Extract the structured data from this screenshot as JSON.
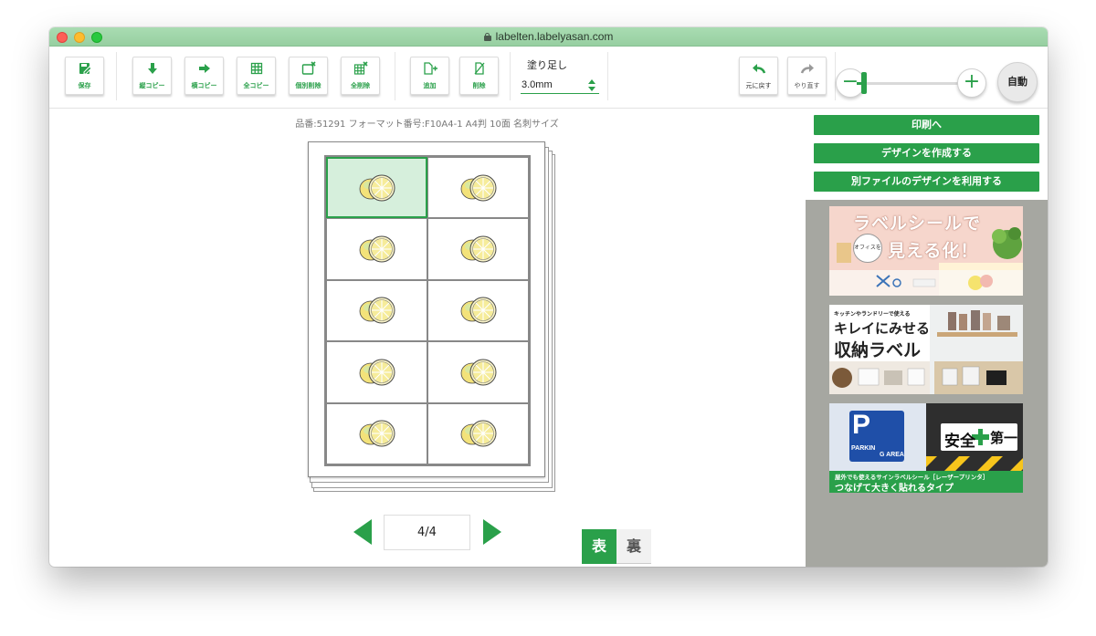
{
  "window": {
    "url": "labelten.labelyasan.com"
  },
  "toolbar": {
    "save": "保存",
    "vertical_copy": "縦コピー",
    "horizontal_copy": "横コピー",
    "all_copy": "全コピー",
    "individual_delete": "個別削除",
    "delete_all": "全削除",
    "add": "追加",
    "delete": "削除",
    "bleed_label": "塗り足し",
    "bleed_value": "3.0mm",
    "undo": "元に戻す",
    "redo": "やり直す",
    "zoom_minus": "−",
    "zoom_plus": "+",
    "auto": "自動",
    "zoom_level": 0.07
  },
  "product_info": "品番:51291 フォーマット番号:F10A4-1 A4判 10面 名刺サイズ",
  "pager": {
    "current": "4/4"
  },
  "face": {
    "front": "表",
    "back": "裏"
  },
  "sidebar": {
    "print": "印刷へ",
    "create_design": "デザインを作成する",
    "use_other_file": "別ファイルのデザインを利用する"
  },
  "ads": {
    "ad1": {
      "line1": "ラベルシールで",
      "badge": "オフィスを",
      "line2": "見える化！"
    },
    "ad2": {
      "caption": "キッチンやランドリーで使える",
      "line1": "キレイにみせる",
      "line2": "収納ラベル"
    },
    "ad3": {
      "sign1": "PARKIN",
      "sign2": "G AREA",
      "safety": "安全",
      "safety2": "第一",
      "caption": "屋外でも使えるサインラベルシール［レーザープリンタ］",
      "tagline": "つなげて大きく貼れるタイプ"
    }
  },
  "colors": {
    "accent": "#2aa04a",
    "selected_cell": "#d6efdc",
    "titlebar": "#a9dcb2",
    "ad_panel": "#a6a7a1"
  }
}
